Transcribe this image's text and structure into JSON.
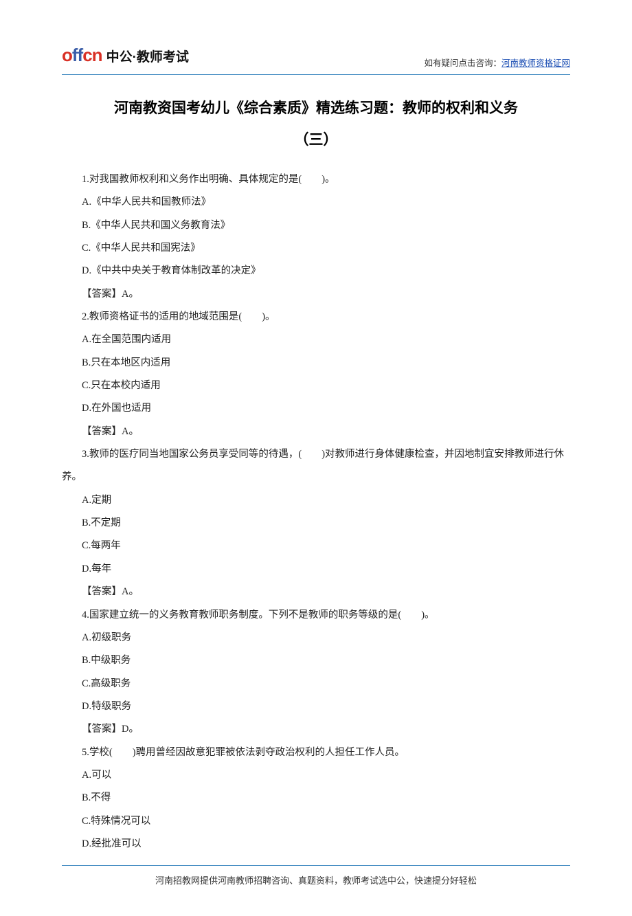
{
  "header": {
    "logo_latin": "offcn",
    "logo_cn": "中公·教师考试",
    "consult_prefix": "如有疑问点击咨询：",
    "consult_link": "河南教师资格证网"
  },
  "title_line1": "河南教资国考幼儿《综合素质》精选练习题：教师的权利和义务",
  "title_line2": "（三）",
  "body": [
    "1.对我国教师权利和义务作出明确、具体规定的是(　　)。",
    "A.《中华人民共和国教师法》",
    "B.《中华人民共和国义务教育法》",
    "C.《中华人民共和国宪法》",
    "D.《中共中央关于教育体制改革的决定》",
    "【答案】A。",
    "2.教师资格证书的适用的地域范围是(　　)。",
    "A.在全国范围内适用",
    "B.只在本地区内适用",
    "C.只在本校内适用",
    "D.在外国也适用",
    "【答案】A。",
    "3.教师的医疗同当地国家公务员享受同等的待遇，(　　)对教师进行身体健康检查，并因地制宜安排教师进行休养。",
    "A.定期",
    "B.不定期",
    "C.每两年",
    "D.每年",
    "【答案】A。",
    "4.国家建立统一的义务教育教师职务制度。下列不是教师的职务等级的是(　　)。",
    "A.初级职务",
    "B.中级职务",
    "C.高级职务",
    "D.特级职务",
    "【答案】D。",
    "5.学校(　　)聘用曾经因故意犯罪被依法剥夺政治权利的人担任工作人员。",
    "A.可以",
    "B.不得",
    "C.特殊情况可以",
    "D.经批准可以"
  ],
  "footer": "河南招教网提供河南教师招聘咨询、真题资料，教师考试选中公，快速提分好轻松"
}
